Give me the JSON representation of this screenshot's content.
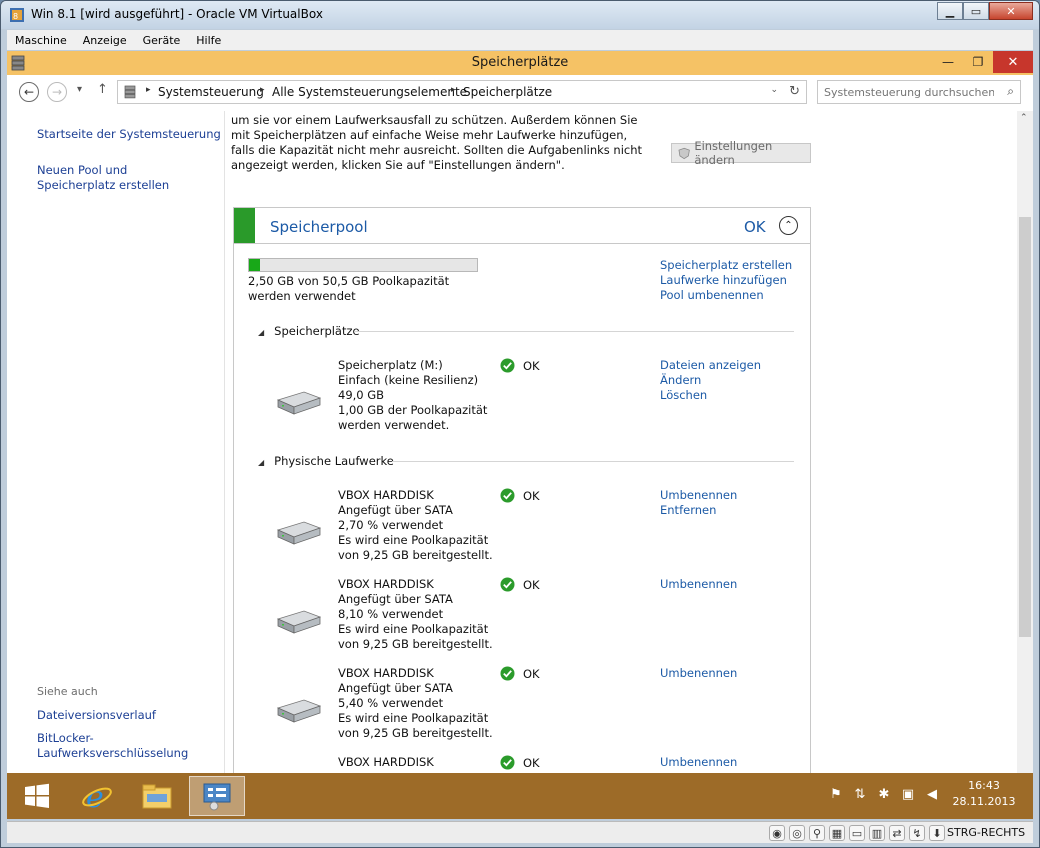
{
  "vbox": {
    "title": "Win 8.1 [wird ausgeführt] - Oracle VM VirtualBox",
    "menu": [
      "Maschine",
      "Anzeige",
      "Geräte",
      "Hilfe"
    ],
    "min": "▁",
    "max": "▭",
    "close": "✕",
    "host_key": "STRG-RECHTS"
  },
  "explorer": {
    "title": "Speicherplätze",
    "min": "—",
    "max": "❐",
    "close": "✕",
    "back": "←",
    "forward": "→",
    "recent": "▾",
    "up": "↑",
    "breadcrumb": [
      "Systemsteuerung",
      "Alle Systemsteuerungselemente",
      "Speicherplätze"
    ],
    "breadcrumb_sep": "▸",
    "dropdown": "⌄",
    "refresh": "↻",
    "search_placeholder": "Systemsteuerung durchsuchen",
    "search_icon": "⌕"
  },
  "left_pane": {
    "links": [
      "Startseite der Systemsteuerung",
      "Neuen Pool und Speicherplatz erstellen"
    ],
    "see_also_title": "Siehe auch",
    "see_also": [
      "Dateiversionsverlauf",
      "BitLocker-Laufwerksverschlüsselung"
    ]
  },
  "main": {
    "intro": "um sie vor einem Laufwerksausfall zu schützen. Außerdem können Sie mit Speicherplätzen auf einfache Weise mehr Laufwerke hinzufügen, falls die Kapazität nicht mehr ausreicht. Sollten die Aufgabenlinks nicht angezeigt werden, klicken Sie auf \"Einstellungen ändern\".",
    "settings_button": "Einstellungen ändern",
    "pool": {
      "title": "Speicherpool",
      "status": "OK",
      "collapse": "⌃",
      "usage_fraction": 0.0495,
      "usage_text": "2,50 GB von 50,5 GB Poolkapazität werden verwendet",
      "links": [
        "Speicherplatz erstellen",
        "Laufwerke hinzufügen",
        "Pool umbenennen"
      ]
    },
    "spaces_title": "Speicherplätze",
    "spaces": [
      {
        "lines": [
          "Speicherplatz (M:)",
          "Einfach (keine Resilienz)",
          "49,0 GB",
          "1,00 GB der Poolkapazität",
          "werden verwendet."
        ],
        "status": "OK",
        "links": [
          "Dateien anzeigen",
          "Ändern",
          "Löschen"
        ]
      }
    ],
    "drives_title": "Physische Laufwerke",
    "drives": [
      {
        "lines": [
          "VBOX HARDDISK",
          "Angefügt über SATA",
          "2,70 % verwendet",
          "Es wird eine Poolkapazität",
          "von 9,25 GB bereitgestellt."
        ],
        "status": "OK",
        "links": [
          "Umbenennen",
          "Entfernen"
        ]
      },
      {
        "lines": [
          "VBOX HARDDISK",
          "Angefügt über SATA",
          "8,10 % verwendet",
          "Es wird eine Poolkapazität",
          "von 9,25 GB bereitgestellt."
        ],
        "status": "OK",
        "links": [
          "Umbenennen"
        ]
      },
      {
        "lines": [
          "VBOX HARDDISK",
          "Angefügt über SATA",
          "5,40 % verwendet",
          "Es wird eine Poolkapazität",
          "von 9,25 GB bereitgestellt."
        ],
        "status": "OK",
        "links": [
          "Umbenennen"
        ]
      },
      {
        "lines": [
          "VBOX HARDDISK"
        ],
        "status": "OK",
        "links": [
          "Umbenennen"
        ]
      }
    ]
  },
  "scroll": {
    "up": "⌃",
    "down": "⌄"
  },
  "taskbar": {
    "time": "16:43",
    "date": "28.11.2013",
    "tray_icons": [
      "flag-icon",
      "network-icon",
      "security-icon",
      "display-icon",
      "volume-icon"
    ]
  },
  "colors": {
    "accent_link": "#1c5aa6",
    "explorer_title": "#f5c265",
    "taskbar": "#9d6b28",
    "ok_green": "#2a9a2a"
  }
}
